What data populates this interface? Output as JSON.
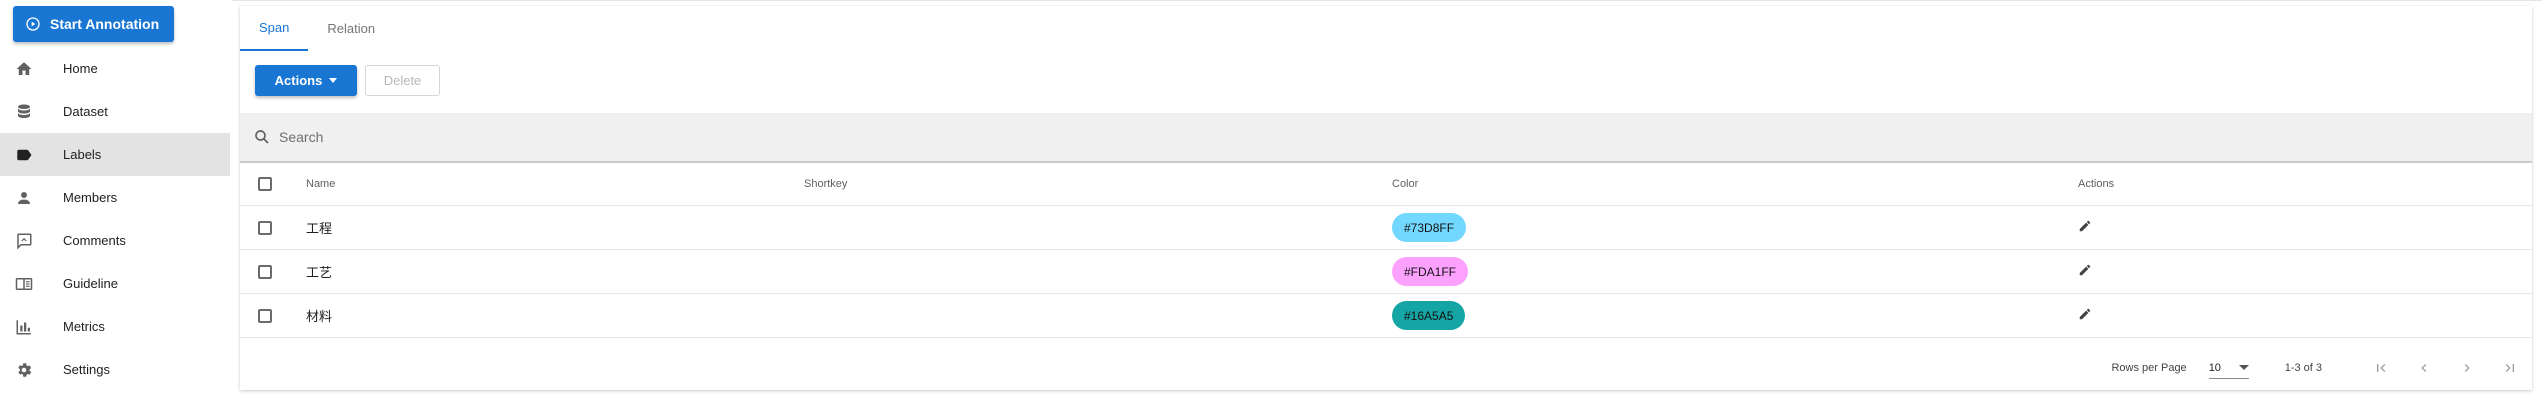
{
  "sidebar": {
    "start_button": {
      "label": "Start Annotation",
      "icon": "play-circle-icon"
    },
    "items": [
      {
        "label": "Home",
        "icon": "home-icon",
        "active": false
      },
      {
        "label": "Dataset",
        "icon": "database-icon",
        "active": false
      },
      {
        "label": "Labels",
        "icon": "label-icon",
        "active": true
      },
      {
        "label": "Members",
        "icon": "account-icon",
        "active": false
      },
      {
        "label": "Comments",
        "icon": "comment-icon",
        "active": false
      },
      {
        "label": "Guideline",
        "icon": "book-icon",
        "active": false
      },
      {
        "label": "Metrics",
        "icon": "chart-icon",
        "active": false
      },
      {
        "label": "Settings",
        "icon": "gear-icon",
        "active": false
      }
    ]
  },
  "tabs": [
    {
      "label": "Span",
      "active": true
    },
    {
      "label": "Relation",
      "active": false
    }
  ],
  "toolbar": {
    "actions_label": "Actions",
    "delete_label": "Delete"
  },
  "search": {
    "placeholder": "Search",
    "value": ""
  },
  "table": {
    "headers": {
      "name": "Name",
      "shortkey": "Shortkey",
      "color": "Color",
      "actions": "Actions"
    },
    "rows": [
      {
        "name": "工程",
        "shortkey": "",
        "color": "#73D8FF"
      },
      {
        "name": "工艺",
        "shortkey": "",
        "color": "#FDA1FF"
      },
      {
        "name": "材料",
        "shortkey": "",
        "color": "#16A5A5"
      }
    ]
  },
  "footer": {
    "rows_per_page_label": "Rows per Page",
    "rows_per_page_value": "10",
    "range_text": "1-3 of 3"
  },
  "colors": {
    "primary": "#1976d2",
    "active_nav_bg": "#e3e3e3"
  }
}
